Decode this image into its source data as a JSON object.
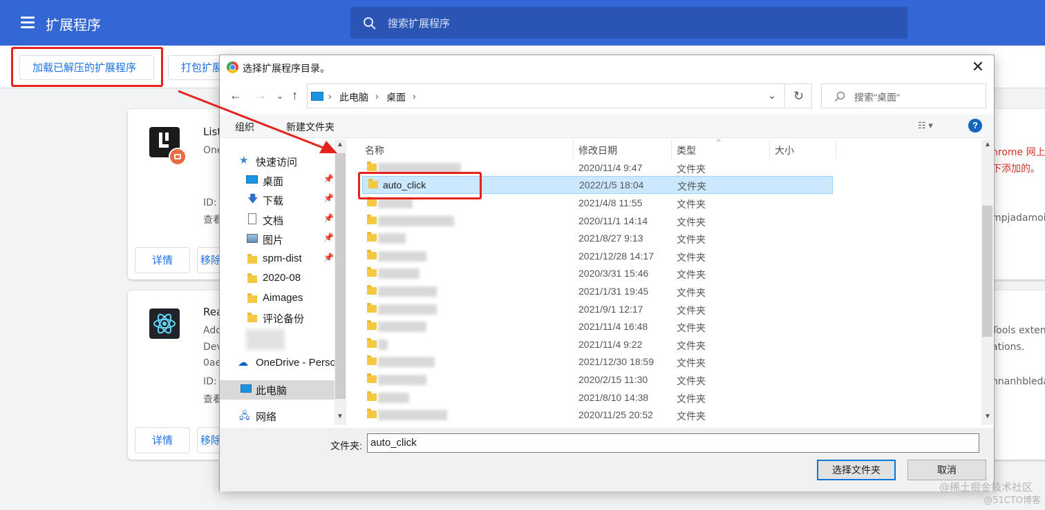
{
  "header": {
    "title": "扩展程序",
    "search_placeholder": "搜索扩展程序"
  },
  "toolbar": {
    "load_unpacked": "加载已解压的扩展程序",
    "pack": "打包扩展程序"
  },
  "cards": [
    {
      "name": "List",
      "line1": "One",
      "id_label": "ID:",
      "view_label": "查看",
      "details": "详情",
      "remove": "移除",
      "right_line1": "hrome 网上",
      "right_line2": "下添加的。",
      "right_line3": "mpjadamoi"
    },
    {
      "name": "Rea",
      "line1": "Add",
      "line2": "Dev",
      "line3": "0ae",
      "id_label": "ID:",
      "view_label": "查看",
      "details": "详情",
      "remove": "移除",
      "right_line1": "Tools exten",
      "right_line2": "ations.",
      "right_line3": "nnanhbleda"
    }
  ],
  "dialog": {
    "title": "选择扩展程序目录。",
    "breadcrumb": [
      "此电脑",
      "桌面"
    ],
    "search_placeholder": "搜索\"桌面\"",
    "organize": "组织",
    "new_folder": "新建文件夹",
    "help": "?",
    "nav": [
      {
        "label": "快速访问",
        "icon": "star-icon",
        "pinned": false
      },
      {
        "label": "桌面",
        "icon": "desktop-icon",
        "pinned": true
      },
      {
        "label": "下载",
        "icon": "download-icon",
        "pinned": true
      },
      {
        "label": "文档",
        "icon": "document-icon",
        "pinned": true
      },
      {
        "label": "图片",
        "icon": "picture-icon",
        "pinned": true
      },
      {
        "label": "spm-dist",
        "icon": "folder-icon",
        "pinned": true
      },
      {
        "label": "2020-08",
        "icon": "folder-icon",
        "pinned": false
      },
      {
        "label": "Aimages",
        "icon": "folder-icon",
        "pinned": false
      },
      {
        "label": "评论备份",
        "icon": "folder-icon",
        "pinned": false
      },
      {
        "label": "OneDrive - Perso",
        "icon": "cloud-icon",
        "pinned": false
      },
      {
        "label": "此电脑",
        "icon": "computer-icon",
        "pinned": false
      },
      {
        "label": "网络",
        "icon": "network-icon",
        "pinned": false
      }
    ],
    "columns": {
      "name": "名称",
      "date": "修改日期",
      "type": "类型",
      "size": "大小"
    },
    "files": [
      {
        "name": "",
        "date": "2020/11/4 9:47",
        "type": "文件夹"
      },
      {
        "name": "auto_click",
        "date": "2022/1/5 18:04",
        "type": "文件夹"
      },
      {
        "name": "",
        "date": "2021/4/8 11:55",
        "type": "文件夹"
      },
      {
        "name": "",
        "date": "2020/11/1 14:14",
        "type": "文件夹"
      },
      {
        "name": "",
        "date": "2021/8/27 9:13",
        "type": "文件夹"
      },
      {
        "name": "",
        "date": "2021/12/28 14:17",
        "type": "文件夹"
      },
      {
        "name": "",
        "date": "2020/3/31 15:46",
        "type": "文件夹"
      },
      {
        "name": "",
        "date": "2021/1/31 19:45",
        "type": "文件夹"
      },
      {
        "name": "",
        "date": "2021/9/1 12:17",
        "type": "文件夹"
      },
      {
        "name": "",
        "date": "2021/11/4 16:48",
        "type": "文件夹"
      },
      {
        "name": "",
        "date": "2021/11/4 9:22",
        "type": "文件夹"
      },
      {
        "name": "",
        "date": "2021/12/30 18:59",
        "type": "文件夹"
      },
      {
        "name": "",
        "date": "2020/2/15 11:30",
        "type": "文件夹"
      },
      {
        "name": "",
        "date": "2021/8/10 14:38",
        "type": "文件夹"
      },
      {
        "name": "",
        "date": "2020/11/25 20:52",
        "type": "文件夹"
      }
    ],
    "folder_label": "文件夹:",
    "folder_value": "auto_click",
    "select_button": "选择文件夹",
    "cancel_button": "取消"
  },
  "watermark": "@稀土掘金技术社区",
  "watermark2": "@51CTO博客",
  "colors": {
    "chrome_blue": "#3367d6",
    "highlight_red": "#e5231c",
    "link_blue": "#1a73e8"
  }
}
